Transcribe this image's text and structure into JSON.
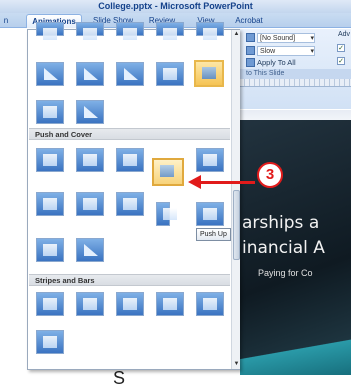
{
  "window": {
    "title": "College.pptx - Microsoft PowerPoint"
  },
  "tabs": [
    {
      "label": "n"
    },
    {
      "label": "Animations",
      "active": true
    },
    {
      "label": "Slide Show"
    },
    {
      "label": "Review"
    },
    {
      "label": "View"
    },
    {
      "label": "Acrobat"
    }
  ],
  "ribbon": {
    "sound_value": "[No Sound]",
    "speed_value": "Slow",
    "apply_all_label": "Apply To All",
    "group_label": "to This Slide",
    "advance_label": "Adv"
  },
  "gallery": {
    "sections": [
      {
        "label": "Push and Cover"
      },
      {
        "label": "Stripes and Bars"
      }
    ],
    "tooltip": "Push Up"
  },
  "callout": {
    "number": "3"
  },
  "slide": {
    "title_line1": "arships a",
    "title_line2": "inancial A",
    "subtitle": "Paying for Co"
  },
  "bottom_text": "S",
  "colors": {
    "accent": "#e11b1b",
    "selection": "#f5c455"
  }
}
